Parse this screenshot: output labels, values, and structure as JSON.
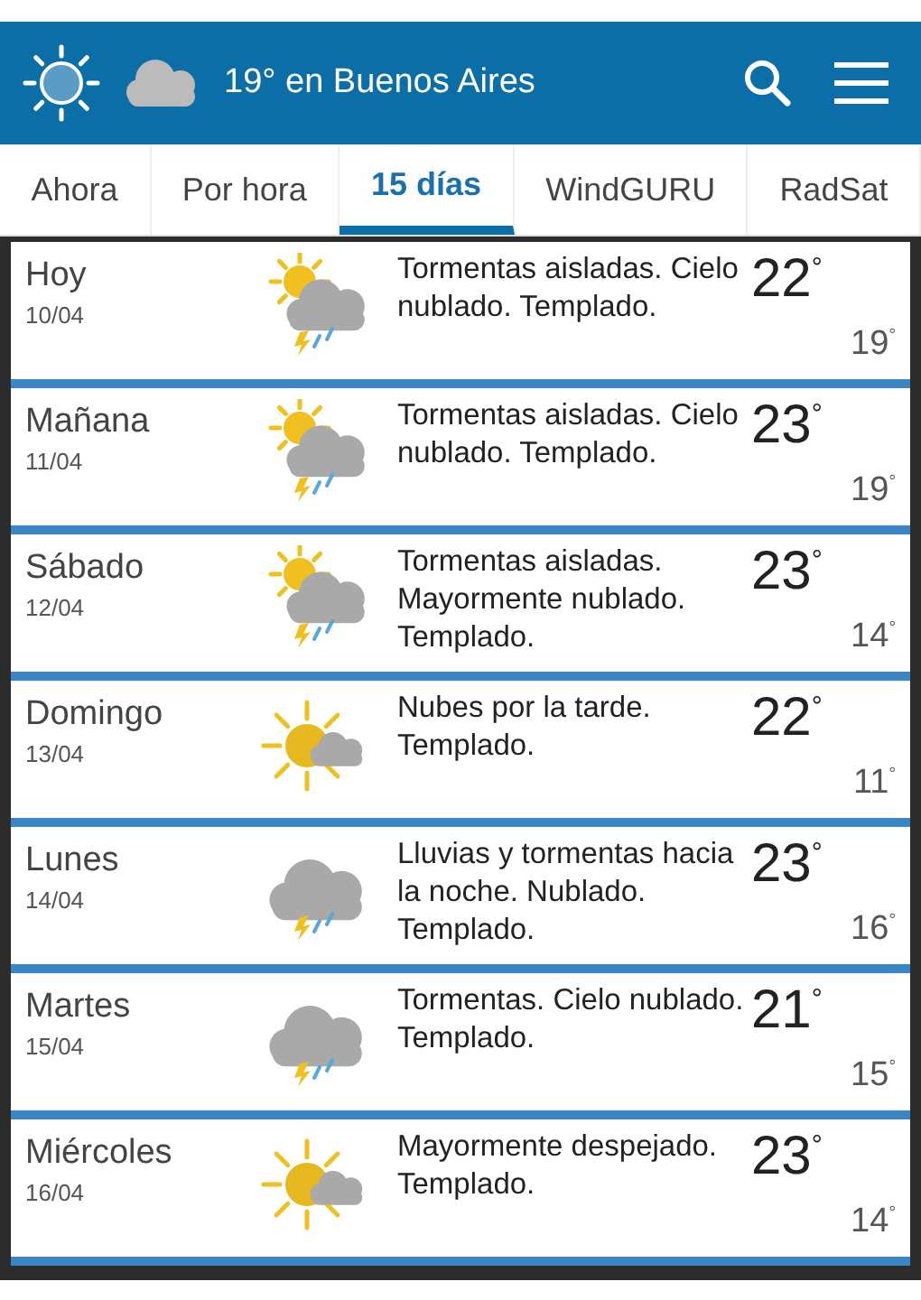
{
  "header": {
    "title": "19° en Buenos Aires"
  },
  "tabs": [
    {
      "label": "Ahora",
      "selected": false
    },
    {
      "label": "Por hora",
      "selected": false
    },
    {
      "label": "15 días",
      "selected": true
    },
    {
      "label": "WindGURU",
      "selected": false
    },
    {
      "label": "RadSat",
      "selected": false
    }
  ],
  "days": [
    {
      "day": "Hoy",
      "date": "10/04",
      "kind": "storm",
      "summary": "Tormentas aisladas. Cielo nublado. Templado.",
      "high": "22$^{°}$",
      "low": "19$^{°}$"
    },
    {
      "day": "Mañana",
      "date": "11/04",
      "kind": "storm",
      "summary": "Tormentas aisladas. Cielo nublado. Templado.",
      "high": "23$^{°}$",
      "low": "19$^{°}$"
    },
    {
      "day": "Sábado",
      "date": "12/04",
      "kind": "storm",
      "summary": "Tormentas aisladas. Mayormente nublado. Templado.",
      "high": "23$^{°}$",
      "low": "14$^{°}$"
    },
    {
      "day": "Domingo",
      "date": "13/04",
      "kind": "sunny",
      "summary": "Nubes por la tarde. Templado.",
      "high": "22$^{°}$",
      "low": "11$^{°}$"
    },
    {
      "day": "Lunes",
      "date": "14/04",
      "kind": "rain",
      "summary": "Lluvias y tormentas hacia la noche. Nublado. Templado.",
      "high": "23$^{°}$",
      "low": "16$^{°}$"
    },
    {
      "day": "Martes",
      "date": "15/04",
      "kind": "rain",
      "summary": "Tormentas. Cielo nublado. Templado.",
      "high": "21$^{°}$",
      "low": "15$^{°}$"
    },
    {
      "day": "Miércoles",
      "date": "16/04",
      "kind": "sunny",
      "summary": "Mayormente despejado. Templado.",
      "high": "23$^{°}$",
      "low": "14$^{°}$"
    }
  ]
}
